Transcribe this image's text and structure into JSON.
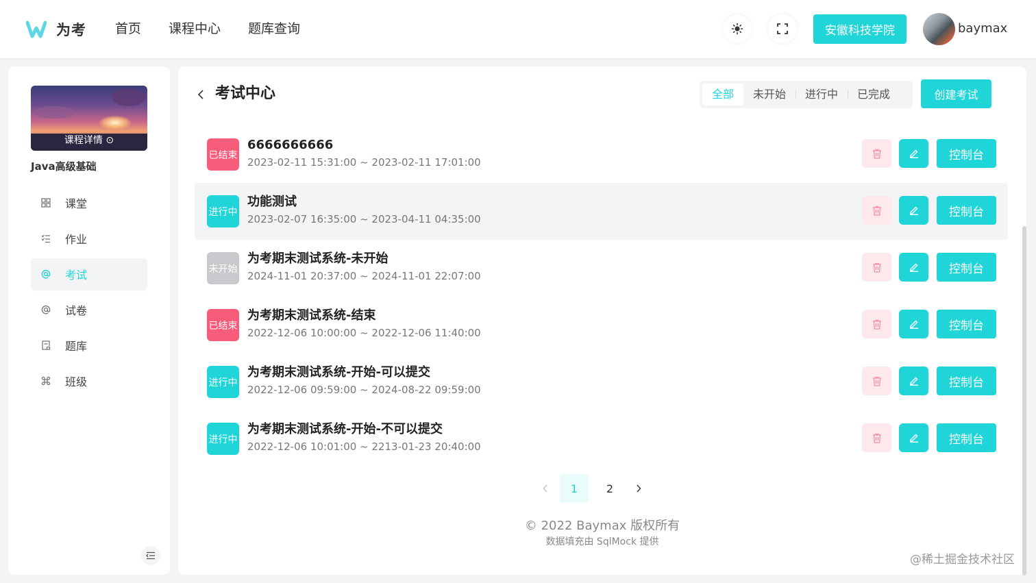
{
  "colors": {
    "accent": "#1fd5d8",
    "ended": "#f75c7a",
    "running": "#1fd5d8",
    "not_started": "#c8c9cc",
    "danger_bg": "#fde8ec",
    "danger_icon": "#f78ea3"
  },
  "header": {
    "logo_text": "为考",
    "nav": [
      "首页",
      "课程中心",
      "题库查询"
    ],
    "theme_icon": "sun-icon",
    "fullscreen_icon": "fullscreen-icon",
    "org_button": "安徽科技学院",
    "username": "baymax"
  },
  "sidebar": {
    "cover_link": "课程详情 ⊙",
    "course_name": "Java高级基础",
    "items": [
      {
        "label": "课堂",
        "icon": "grid-icon",
        "active": false
      },
      {
        "label": "作业",
        "icon": "checklist-icon",
        "active": false
      },
      {
        "label": "考试",
        "icon": "at-icon",
        "active": true
      },
      {
        "label": "试卷",
        "icon": "at-icon",
        "active": false
      },
      {
        "label": "题库",
        "icon": "document-icon",
        "active": false
      },
      {
        "label": "班级",
        "icon": "command-icon",
        "active": false
      }
    ]
  },
  "main": {
    "title": "考试中心",
    "filters": [
      "全部",
      "未开始",
      "进行中",
      "已完成"
    ],
    "active_filter": "全部",
    "create_button": "创建考试",
    "console_label": "控制台",
    "exams": [
      {
        "status": "已结束",
        "status_type": "ended",
        "title": "6666666666",
        "time": "2023-02-11 15:31:00 ~ 2023-02-11 17:01:00"
      },
      {
        "status": "进行中",
        "status_type": "running",
        "title": "功能测试",
        "time": "2023-02-07 16:35:00 ~ 2023-04-11 04:35:00"
      },
      {
        "status": "未开始",
        "status_type": "not_started",
        "title": "为考期末测试系统-未开始",
        "time": "2024-11-01 20:37:00 ~ 2024-11-01 22:07:00"
      },
      {
        "status": "已结束",
        "status_type": "ended",
        "title": "为考期末测试系统-结束",
        "time": "2022-12-06 10:00:00 ~ 2022-12-06 11:40:00"
      },
      {
        "status": "进行中",
        "status_type": "running",
        "title": "为考期末测试系统-开始-可以提交",
        "time": "2022-12-06 09:59:00 ~ 2024-08-22 09:59:00"
      },
      {
        "status": "进行中",
        "status_type": "running",
        "title": "为考期末测试系统-开始-不可以提交",
        "time": "2022-12-06 10:01:00 ~ 2213-01-23 20:40:00"
      }
    ],
    "pagination": {
      "pages": [
        "1",
        "2"
      ],
      "current": "1"
    },
    "footer_copy": "© 2022 Baymax 版权所有",
    "footer_sub": "数据填充由 SqlMock 提供"
  },
  "watermark": "@稀土掘金技术社区"
}
